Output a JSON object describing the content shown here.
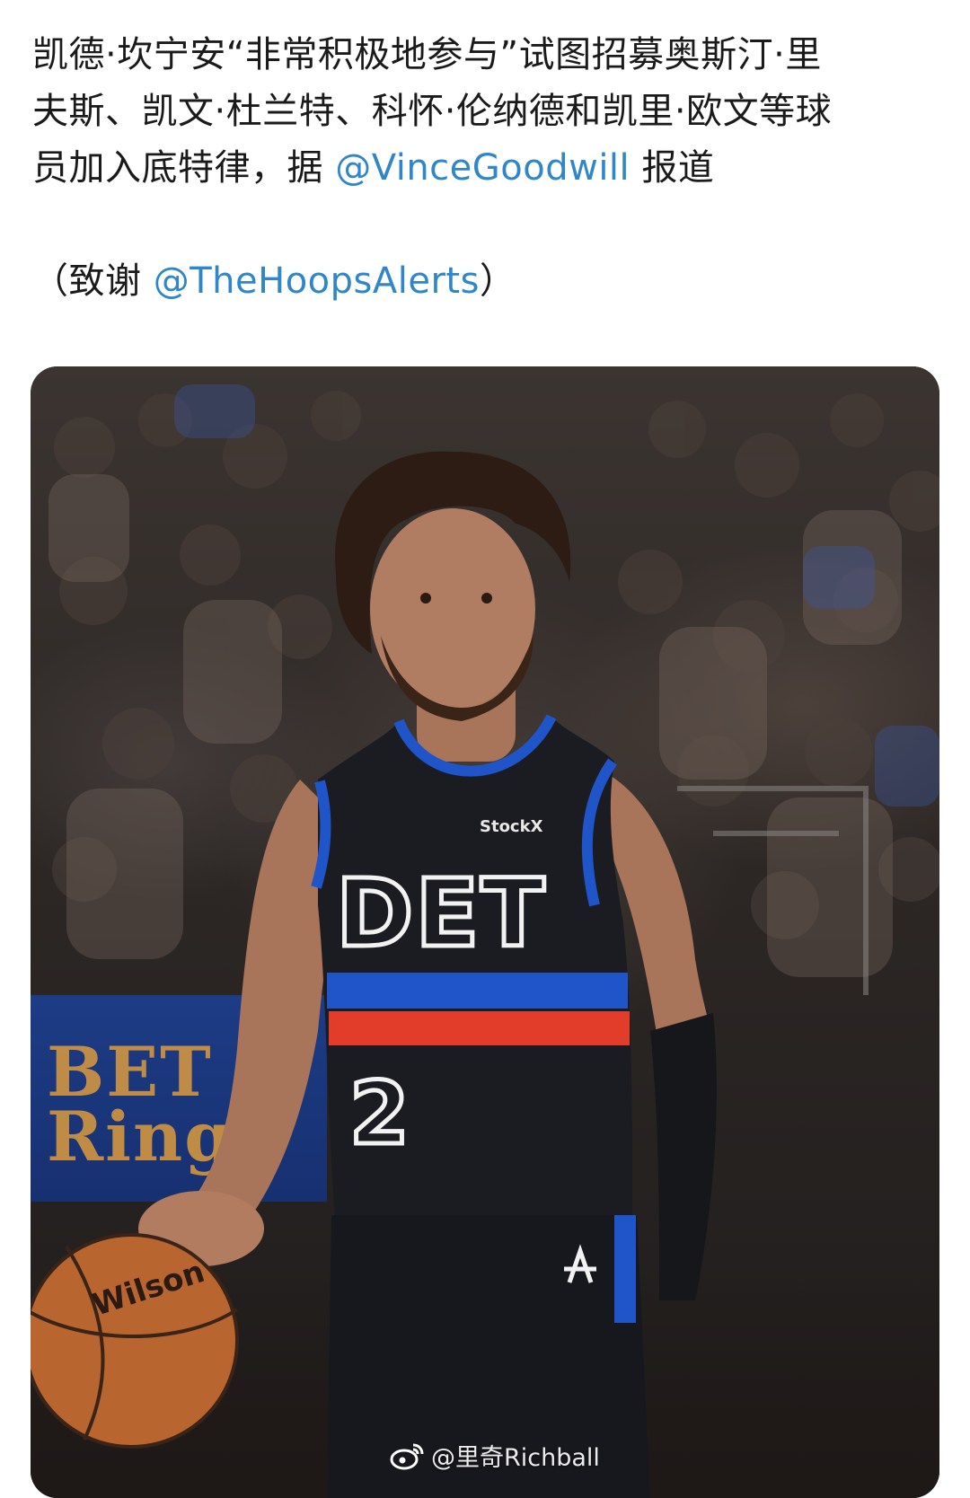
{
  "post": {
    "line1": "凯德·坎宁安“非常积极地参与”试图招募奥斯汀·里",
    "line2": "夫斯、凯文·杜兰特、科怀·伦纳德和凯里·欧文等球",
    "line3_prefix": "员加入底特律，据 ",
    "line3_mention": "@VinceGoodwill",
    "line3_suffix": " 报道",
    "credit_prefix": "（致谢 ",
    "credit_mention": "@TheHoopsAlerts",
    "credit_suffix": "）"
  },
  "media": {
    "jersey_brand": "StockX",
    "jersey_team": "DET",
    "jersey_number": "2",
    "ball_brand": "Wilson",
    "watermark": "@里奇Richball"
  },
  "colors": {
    "mention": "#2f86c9",
    "jersey_black": "#1b1c22",
    "jersey_blue": "#1f55c8",
    "jersey_red": "#e23d2a"
  }
}
